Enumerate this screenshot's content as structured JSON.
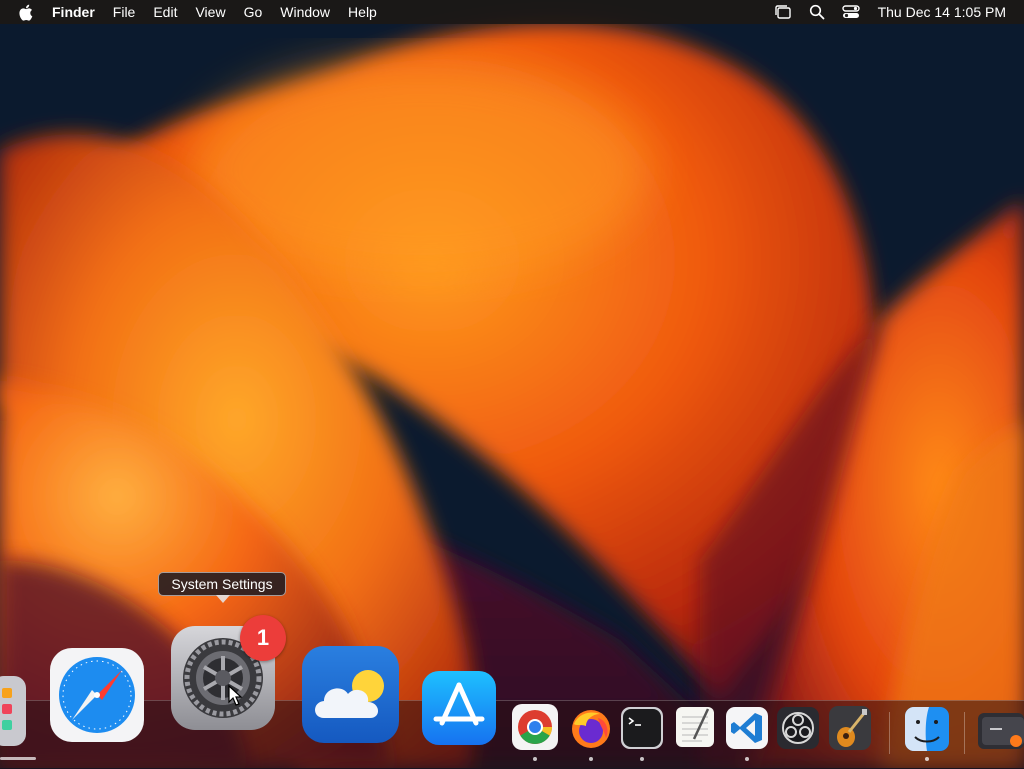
{
  "menubar": {
    "app_name": "Finder",
    "menus": [
      "File",
      "Edit",
      "View",
      "Go",
      "Window",
      "Help"
    ],
    "status_icons": [
      "stage-manager-icon",
      "spotlight-search-icon",
      "control-center-icon"
    ],
    "clock": "Thu Dec 14  1:05 PM"
  },
  "dock": {
    "tooltip": "System Settings",
    "badge_count": "1",
    "apps": [
      "Launchpad",
      "Safari",
      "System Settings",
      "Weather",
      "App Store",
      "Google Chrome",
      "Firefox",
      "Terminal",
      "TextEdit",
      "Visual Studio Code",
      "OBS",
      "GarageBand",
      "Finder",
      "Downloads"
    ]
  },
  "colors": {
    "menubar_bg": "#1c1816",
    "badge_red": "#ec3d3a",
    "wallpaper_orange": "#f07a12",
    "wallpaper_navy": "#0b1a2e"
  }
}
